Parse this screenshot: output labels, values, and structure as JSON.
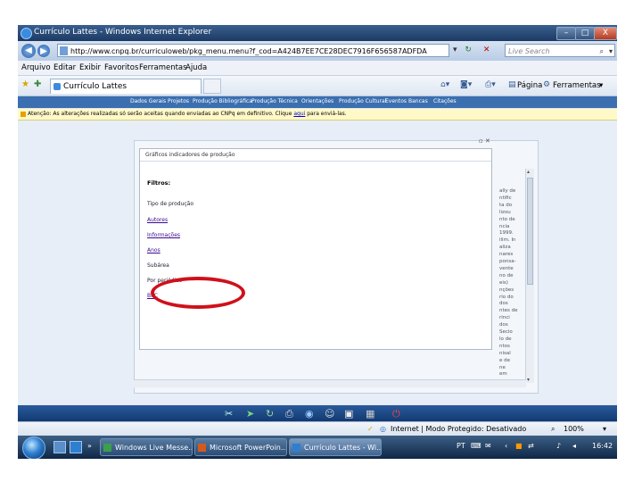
{
  "window": {
    "title": "Currículo Lattes - Windows Internet Explorer",
    "min": "–",
    "max": "□",
    "close": "X"
  },
  "address": {
    "url": "http://www.cnpq.br/curriculoweb/pkg_menu.menu?f_cod=A424B7EE7CE28DEC7916F656587ADFDA",
    "search_placeholder": "Live Search"
  },
  "menu": [
    "Arquivo",
    "Editar",
    "Exibir",
    "Favoritos",
    "Ferramentas",
    "Ajuda"
  ],
  "tab": {
    "label": "Currículo Lattes"
  },
  "commandbar": {
    "page": "Página",
    "tools": "Ferramentas"
  },
  "sitenav": [
    "Dados Gerais",
    "Projetos",
    "Produção Bibliográfica",
    "Produção Técnica",
    "Orientações",
    "Produção Cultural",
    "Eventos",
    "Bancas",
    "Citações"
  ],
  "warning": {
    "text_before": "Atenção: As alterações realizadas só serão aceitas quando enviadas ao CNPq em definitivo. Clique",
    "link": "aqui",
    "text_after": "para enviá-las."
  },
  "dialog": {
    "header": "Gráficos indicadores de produção",
    "filtros_label": "Filtros:",
    "links": [
      "Tipo de produção",
      "Autores",
      "Informações",
      "Anos",
      "Subárea",
      "Por periódico",
      "BPC"
    ]
  },
  "right_text": [
    "ally de",
    "ntific",
    "ta do",
    "lizou",
    "nto de",
    "ncia",
    "1999.",
    "ilim. In",
    "aliza",
    "nares",
    "ponsa-",
    "vente",
    "no de",
    "eis)",
    "nções",
    "rio do",
    "dos",
    "ntes de",
    "rinci",
    "dos",
    "Secio",
    "lo de",
    "ntos",
    "nisal",
    "e de",
    "ne",
    "em"
  ],
  "ie_status": {
    "zone": "Internet | Modo Protegido: Desativado",
    "zoom": "100%"
  },
  "taskbar": {
    "tasks": [
      {
        "label": "Windows Live Messe...",
        "color": "#3aa04a"
      },
      {
        "label": "Microsoft PowerPoin...",
        "color": "#d35a1f"
      },
      {
        "label": "Currículo Lattes - Wi...",
        "color": "#2f7fd0"
      }
    ],
    "lang": "PT",
    "time": "16:42"
  },
  "colors": {
    "highlight_oval": "#d0101a",
    "site_nav": "#3b6fb0",
    "warning_bg": "#fff9c8"
  }
}
